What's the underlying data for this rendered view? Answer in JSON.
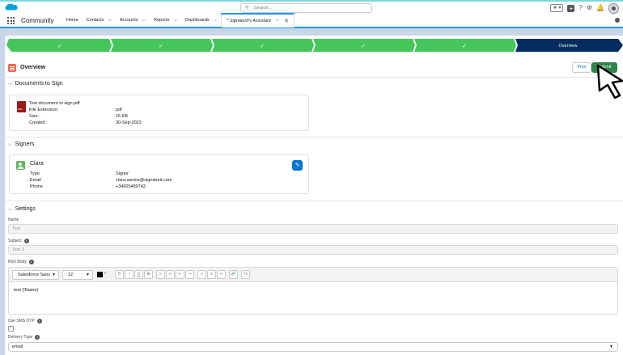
{
  "header": {
    "search_placeholder": "Search...",
    "favorites_glyph": "★ ▾",
    "plus_glyph": "+",
    "help_glyph": "?",
    "setup_glyph": "⚙",
    "bell_glyph": "🔔"
  },
  "nav": {
    "app_name": "Community",
    "items": [
      {
        "label": "Home",
        "has_menu": false
      },
      {
        "label": "Contacts",
        "has_menu": true
      },
      {
        "label": "Accounts",
        "has_menu": true
      },
      {
        "label": "Reports",
        "has_menu": true
      },
      {
        "label": "Dashboards",
        "has_menu": true
      }
    ],
    "active_tab": "* Signaturit's Assistant",
    "chevron": "⌵",
    "close": "✕"
  },
  "path": {
    "completed_glyph": "✓",
    "current_label": "Overview",
    "completed_color": "#45c65a",
    "current_color": "#032d60"
  },
  "page": {
    "title": "Overview",
    "prev_label": "Prev",
    "submit_label": "Submit"
  },
  "documents": {
    "section_title": "Documents to Sign",
    "file_name": "Test document to sign.pdf",
    "fields": [
      {
        "label": "File Extension:",
        "value": "pdf"
      },
      {
        "label": "Size :",
        "value": "15 KB"
      },
      {
        "label": "Created :",
        "value": "30-Sep-2022"
      }
    ]
  },
  "signers": {
    "section_title": "Signers",
    "name": "Clara",
    "edit_glyph": "✎",
    "fields": [
      {
        "label": "Type",
        "value": "Signer"
      },
      {
        "label": "Email",
        "value": "clara.santos@signaturit.com"
      },
      {
        "label": "Phone",
        "value": "+34605489743"
      }
    ]
  },
  "settings": {
    "section_title": "Settings",
    "name_label": "Name",
    "name_value": "Test",
    "subject_label": "Subject",
    "subject_value": "Test 3",
    "rich_body_label": "Rich Body",
    "font": "Salesforce Sans",
    "font_size": "12",
    "toolbar_buttons": [
      "B",
      "I",
      "U",
      "S",
      "≡",
      "≡",
      "⇤",
      "⇥",
      "≡",
      "≡",
      "≡",
      "🔗",
      "Tx"
    ],
    "body_text": "test {!Name}",
    "sms_label": "Use SMS OTP",
    "sms_checked_glyph": "✓",
    "delivery_label": "Delivery Type",
    "delivery_value": "email",
    "info_glyph": "i",
    "dropdown_glyph": "▼"
  }
}
